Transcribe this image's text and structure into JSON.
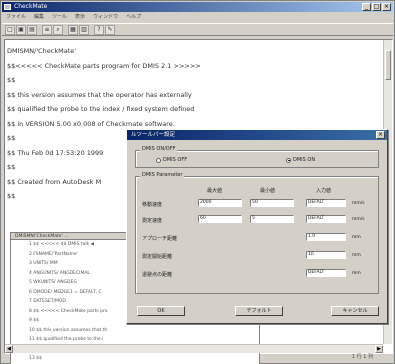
{
  "window": {
    "title": "CheckMate"
  },
  "menu": [
    "ファイル",
    "編集",
    "ツール",
    "表示",
    "ウィンドウ",
    "ヘルプ"
  ],
  "toolbar": [
    "□",
    "▣",
    "▤",
    "≡",
    "⌕",
    "▦",
    "▥",
    "?",
    "✎"
  ],
  "editor": {
    "lines": [
      "DMISMN/'CheckMate'",
      "$$<<<<< CheckMate parts program for DMIS 2.1 >>>>>",
      "$$",
      "$$   this version assumes that the operator has externally",
      "$$   qualified the  probe to the index / fixed system defined",
      "$$   in VERSION 5.00  x0.008 of Checkmate software.",
      "$$",
      "$$ Thu Feb 0d 17:53:20 1999",
      "$$",
      "$$ Created from AutoDesk M",
      "$$"
    ]
  },
  "panel2": {
    "header": "DMISMN/'CheckMate' ...",
    "lines": [
      "1  $$ <<<<< $$ DMIS talk ◀",
      "2  FSNAME/'PartName'",
      "3  UNITS/ MM",
      "4  ANGUNITS/ ANGDECIMAL",
      "5  WKUNITS/ ANGDEG",
      "6  DMODE/ MEDGE1 = DEFALT, C",
      "7  DATESET/MOD",
      "8  $$ <<<<< CheckMate parts pro",
      "9  $$",
      "10 $$ this version assumes that th",
      "11 $$ qualified the  probe to the i",
      "12 $$ in VERSION 5.00 x0.008 of Checkmate software",
      "13 $$"
    ]
  },
  "dialog": {
    "title": "ルツールバー設定",
    "group1_label": "DMIS ON/OFF",
    "radio_off": "DMIS OFF",
    "radio_on": "DMIS ON",
    "radio_selected": "on",
    "group2_label": "DMIS Parameter",
    "columns": [
      "最大値",
      "最小値",
      "入力値"
    ],
    "rows": [
      {
        "label": "移動速度",
        "max": "2000",
        "min": "50",
        "value": "DEFALT",
        "unit": "mm/s"
      },
      {
        "label": "測定速度",
        "max": "60",
        "min": "5",
        "value": "DEFALT",
        "unit": "mm/s"
      },
      {
        "label": "アプローチ距離",
        "max": "",
        "min": "",
        "value": "1.0",
        "unit": "mm"
      },
      {
        "label": "測定開始距離",
        "max": "",
        "min": "",
        "value": "10",
        "unit": "mm"
      },
      {
        "label": "退避点の距離",
        "max": "",
        "min": "",
        "value": "DEFALT",
        "unit": "mm"
      }
    ],
    "ok": "OK",
    "apply": "デフォルト",
    "cancel": "キャンセル"
  },
  "status": "1 行 1 列"
}
